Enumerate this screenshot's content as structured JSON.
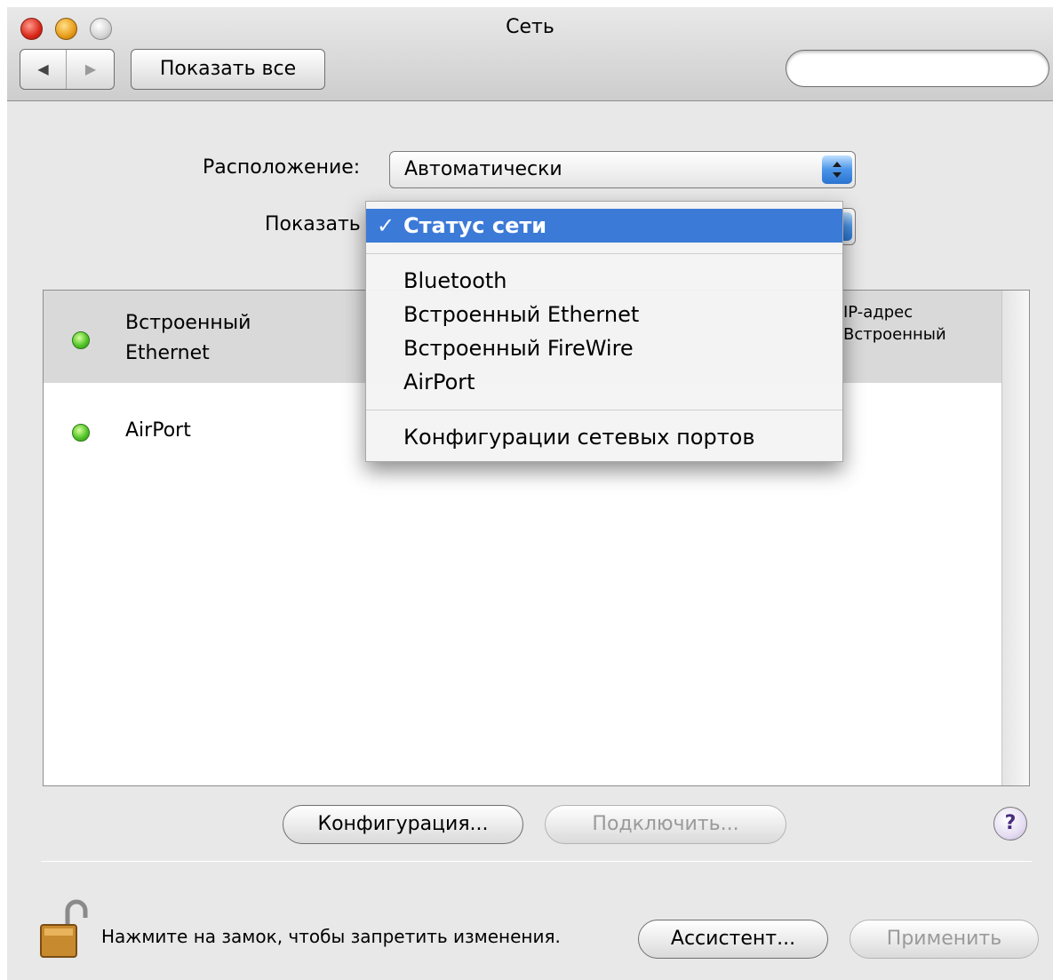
{
  "window": {
    "title": "Сеть"
  },
  "toolbar": {
    "back_label": "◀",
    "forward_label": "▶",
    "show_all_label": "Показать все",
    "search": {
      "value": "",
      "placeholder": ""
    }
  },
  "location": {
    "label": "Расположение:",
    "value": "Автоматически"
  },
  "show": {
    "label": "Показать"
  },
  "show_menu": {
    "checkmark": "✓",
    "selected": "Статус сети",
    "groups": [
      [
        "Статус сети"
      ],
      [
        "Bluetooth",
        "Встроенный Ethernet",
        "Встроенный FireWire",
        "AirPort"
      ],
      [
        "Конфигурации сетевых портов"
      ]
    ]
  },
  "status_list": {
    "rows": [
      {
        "name": "Встроенный Ethernet",
        "name_line1": "Встроенный",
        "name_line2": "Ethernet",
        "status": "green",
        "info_line1": "IP-адрес",
        "info_line2": "Встроенный"
      },
      {
        "name": "AirPort",
        "status": "green"
      }
    ]
  },
  "buttons": {
    "configure": "Конфигурация...",
    "connect": "Подключить...",
    "help": "?",
    "assistant": "Ассистент...",
    "apply": "Применить"
  },
  "lock": {
    "text": "Нажмите на замок, чтобы запретить изменения.",
    "state": "unlocked"
  },
  "colors": {
    "menu_highlight": "#3c7ad8",
    "status_green": "#54c52a",
    "window_background": "#e8e8e8"
  }
}
